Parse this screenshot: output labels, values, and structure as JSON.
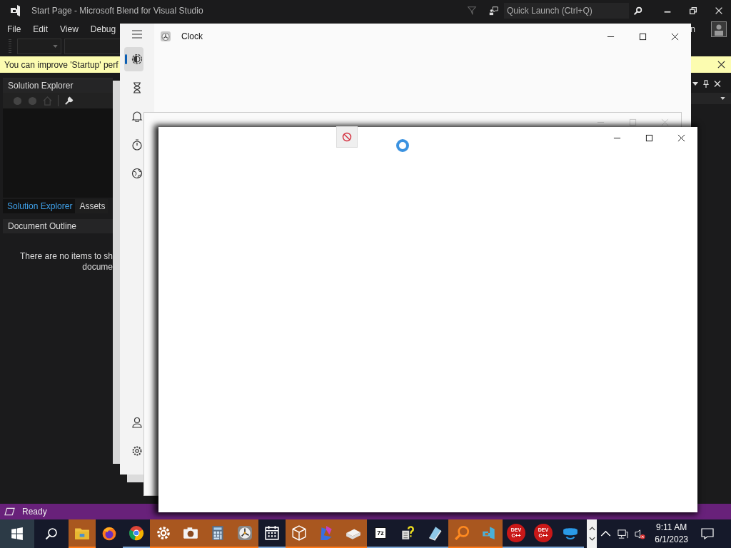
{
  "blend": {
    "title": "Start Page - Microsoft Blend for Visual Studio",
    "quick_launch": {
      "placeholder": "Quick Launch (Ctrl+Q)"
    },
    "menu": [
      "File",
      "Edit",
      "View",
      "Debug"
    ],
    "menu_right_text": "n",
    "info_bar": "You can improve 'Startup' perf",
    "solution_explorer": {
      "title": "Solution Explorer"
    },
    "tabs": [
      {
        "label": "Solution Explorer",
        "selected": true
      },
      {
        "label": "Assets",
        "selected": false
      }
    ],
    "document_outline": {
      "title": "Document Outline",
      "empty_lines": [
        "There are no items to sh",
        "docume"
      ]
    },
    "status": "Ready"
  },
  "clock": {
    "title": "Clock",
    "nav": [
      {
        "selected": true
      },
      {
        "selected": false
      },
      {
        "selected": false
      },
      {
        "selected": false
      },
      {
        "selected": false
      }
    ],
    "nav_bottom": [
      {
        "selected": false
      },
      {
        "selected": false
      }
    ]
  },
  "taskbar": {
    "apps": [
      {
        "flashing": true,
        "running": true
      },
      {
        "flashing": false,
        "running": false
      },
      {
        "flashing": false,
        "running": true
      },
      {
        "flashing": true,
        "running": true
      },
      {
        "flashing": true,
        "running": true
      },
      {
        "flashing": true,
        "running": true
      },
      {
        "flashing": true,
        "running": true
      },
      {
        "flashing": false,
        "running": true
      },
      {
        "flashing": true,
        "running": true
      },
      {
        "flashing": true,
        "running": true
      },
      {
        "flashing": true,
        "running": true
      },
      {
        "flashing": false,
        "running": true,
        "icon_text": "7z"
      },
      {
        "flashing": false,
        "running": true
      },
      {
        "flashing": false,
        "running": true
      },
      {
        "flashing": true,
        "running": true
      },
      {
        "flashing": true,
        "running": true
      },
      {
        "flashing": false,
        "running": true,
        "icon_text": "DEV C++"
      },
      {
        "flashing": false,
        "running": true,
        "icon_text": "DEV C++"
      },
      {
        "flashing": false,
        "running": true
      }
    ],
    "time": "9:11 AM",
    "date": "6/1/2023"
  }
}
